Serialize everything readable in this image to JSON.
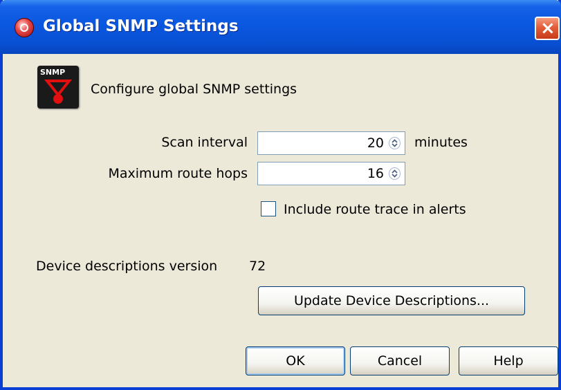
{
  "window": {
    "title": "Global SNMP Settings",
    "close_label": "×"
  },
  "header": {
    "logo_text": "SNMP",
    "description": "Configure global SNMP settings"
  },
  "scan_interval": {
    "label": "Scan interval",
    "value": "20",
    "unit": "minutes"
  },
  "max_route_hops": {
    "label": "Maximum route hops",
    "value": "16"
  },
  "include_route_trace": {
    "label": "Include route trace in alerts",
    "checked": false
  },
  "device_descriptions": {
    "label": "Device descriptions version",
    "version": "72",
    "update_button": "Update Device Descriptions..."
  },
  "buttons": {
    "ok": "OK",
    "cancel": "Cancel",
    "help": "Help"
  },
  "colors": {
    "titlebar": "#0a57e0",
    "dialog_background": "#ece9d8",
    "close_button": "#e35d3a"
  }
}
